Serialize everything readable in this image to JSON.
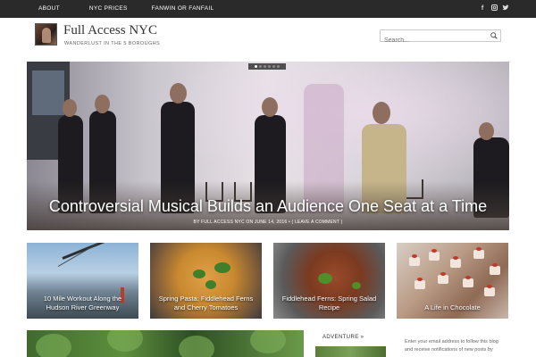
{
  "nav": {
    "items": [
      "ABOUT",
      "NYC PRICES",
      "FANWIN OR FANFAIL"
    ],
    "social_icons": [
      "facebook-icon",
      "instagram-icon",
      "twitter-icon"
    ]
  },
  "site": {
    "title": "Full Access NYC",
    "tagline": "WANDERLUST IN THE 5 BOROUGHS"
  },
  "search": {
    "placeholder": "Search..."
  },
  "featured": {
    "title": "Controversial Musical Builds an Audience One Seat at a Time",
    "meta": "BY FULL ACCESS NYC ON JUNE 14, 2016 • ( LEAVE A COMMENT )",
    "slide_dots": 6,
    "active_dot": 1
  },
  "cards": [
    {
      "caption": "10 Mile Workout Along the Hudson River Greenway"
    },
    {
      "caption": "Spring Pasta: Fiddlehead Ferns and Cherry Tomatoes"
    },
    {
      "caption": "Fiddlehead Ferns: Spring Salad Recipe"
    },
    {
      "caption": "A Life in Chocolate"
    }
  ],
  "sidebar": {
    "adventure_label": "ADVENTURE »",
    "follow_text": "Enter your email address to follow this blog and receive notifications of new posts by"
  },
  "colors": {
    "topbar": "#2a2a2a",
    "text": "#333333"
  }
}
